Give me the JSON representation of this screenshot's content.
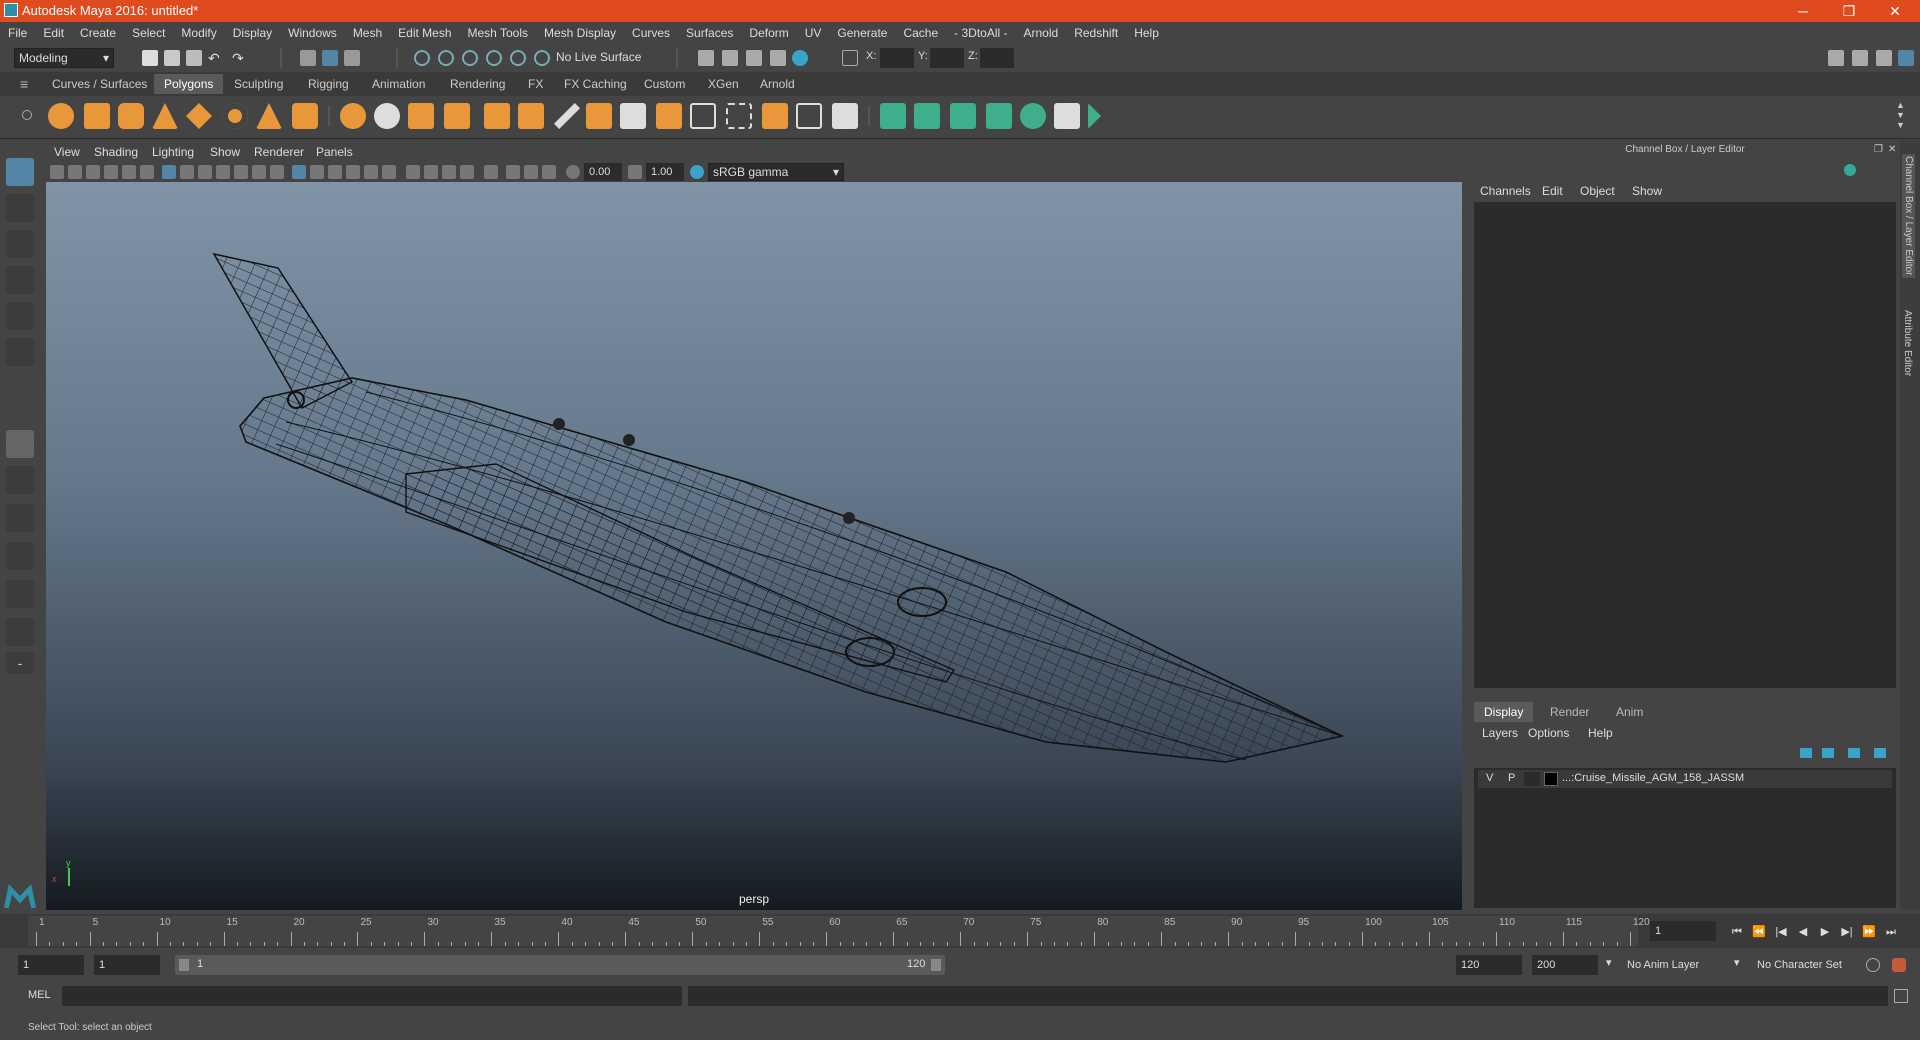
{
  "window": {
    "title": "Autodesk Maya 2016: untitled*",
    "minimize": "─",
    "maximize": "❐",
    "close": "✕"
  },
  "menubar": [
    "File",
    "Edit",
    "Create",
    "Select",
    "Modify",
    "Display",
    "Windows",
    "Mesh",
    "Edit Mesh",
    "Mesh Tools",
    "Mesh Display",
    "Curves",
    "Surfaces",
    "Deform",
    "UV",
    "Generate",
    "Cache",
    "- 3DtoAll -",
    "Arnold",
    "Redshift",
    "Help"
  ],
  "statusline": {
    "mode": "Modeling",
    "live_surface": "No Live Surface",
    "x_label": "X:",
    "y_label": "Y:",
    "z_label": "Z:"
  },
  "shelf": {
    "tabs": [
      "Curves / Surfaces",
      "Polygons",
      "Sculpting",
      "Rigging",
      "Animation",
      "Rendering",
      "FX",
      "FX Caching",
      "Custom",
      "XGen",
      "Arnold"
    ],
    "active_tab": "Polygons"
  },
  "viewport": {
    "menu": [
      "View",
      "Shading",
      "Lighting",
      "Show",
      "Renderer",
      "Panels"
    ],
    "exposure": "0.00",
    "gamma": "1.00",
    "color_space": "sRGB gamma",
    "camera_label": "persp",
    "axis_y": "y",
    "axis_x": "x"
  },
  "channel_box": {
    "title": "Channel Box / Layer Editor",
    "menu": [
      "Channels",
      "Edit",
      "Object",
      "Show"
    ]
  },
  "layer_editor": {
    "tabs": [
      "Display",
      "Render",
      "Anim"
    ],
    "active_tab": "Display",
    "menu": [
      "Layers",
      "Options",
      "Help"
    ],
    "layers": [
      {
        "v": "V",
        "p": "P",
        "name": "...:Cruise_Missile_AGM_158_JASSM"
      }
    ]
  },
  "side_tabs": [
    "Channel Box / Layer Editor",
    "Attribute Editor"
  ],
  "timeline": {
    "ticks": [
      1,
      5,
      10,
      15,
      20,
      25,
      30,
      35,
      40,
      45,
      50,
      55,
      60,
      65,
      70,
      75,
      80,
      85,
      90,
      95,
      100,
      105,
      110,
      115,
      120
    ],
    "current_frame": "1",
    "playback_buttons": [
      "⏮",
      "⏪",
      "|◀",
      "◀",
      "▶",
      "▶|",
      "⏩",
      "⏭"
    ]
  },
  "range": {
    "start": "1",
    "playback_start": "1",
    "slider_start": "1",
    "slider_end": "120",
    "playback_end": "120",
    "end": "200",
    "anim_layer": "No Anim Layer",
    "character_set": "No Character Set"
  },
  "command": {
    "label": "MEL"
  },
  "help_line": "Select Tool: select an object",
  "colors": {
    "title_bar": "#e04a1f",
    "accent": "#5285a6",
    "shelf_orange": "#e8973a",
    "shelf_green": "#3fae8c"
  }
}
